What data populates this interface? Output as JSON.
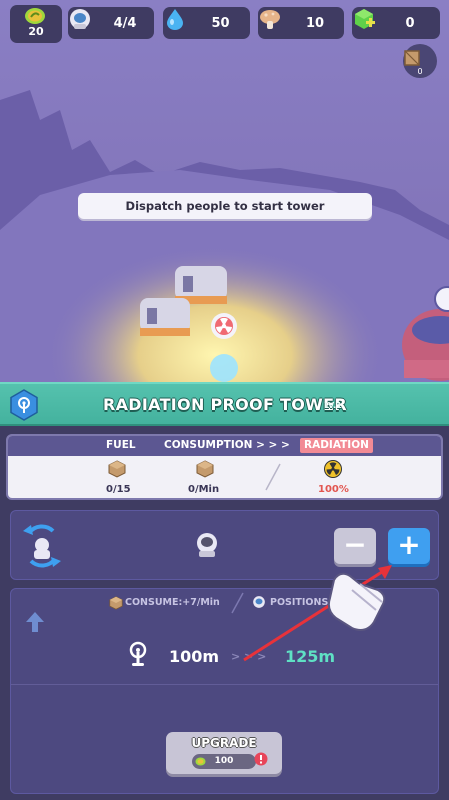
{
  "resources": {
    "days": "20",
    "population": "4/4",
    "water": "50",
    "food": "10",
    "gems": "0"
  },
  "crate_count": "0",
  "tooltip": "Dispatch people to start tower",
  "building": {
    "title": "RADIATION PROOF TOWER",
    "level": "LV.1"
  },
  "info_table": {
    "fuel_label": "FUEL",
    "consumption_label": "CONSUMPTION > > >",
    "radiation_label": "RADIATION",
    "fuel_value": "0/15",
    "consumption_value": "0/Min",
    "radiation_value": "100%"
  },
  "workers": {
    "minus_label": "−",
    "plus_label": "+"
  },
  "upgrade": {
    "consume_text": "CONSUME:+7/Min",
    "positions_text": "POSITIONS",
    "range_current": "100m",
    "range_arrows": "> > >",
    "range_next": "125m",
    "button_label": "UPGRADE",
    "cost": "100"
  },
  "colors": {
    "banner": "#4fbba7",
    "panel": "#3f3c62",
    "plus_button": "#3f9ff0",
    "radiation_tag": "#f28a95",
    "range_next": "#5fe0c4"
  }
}
